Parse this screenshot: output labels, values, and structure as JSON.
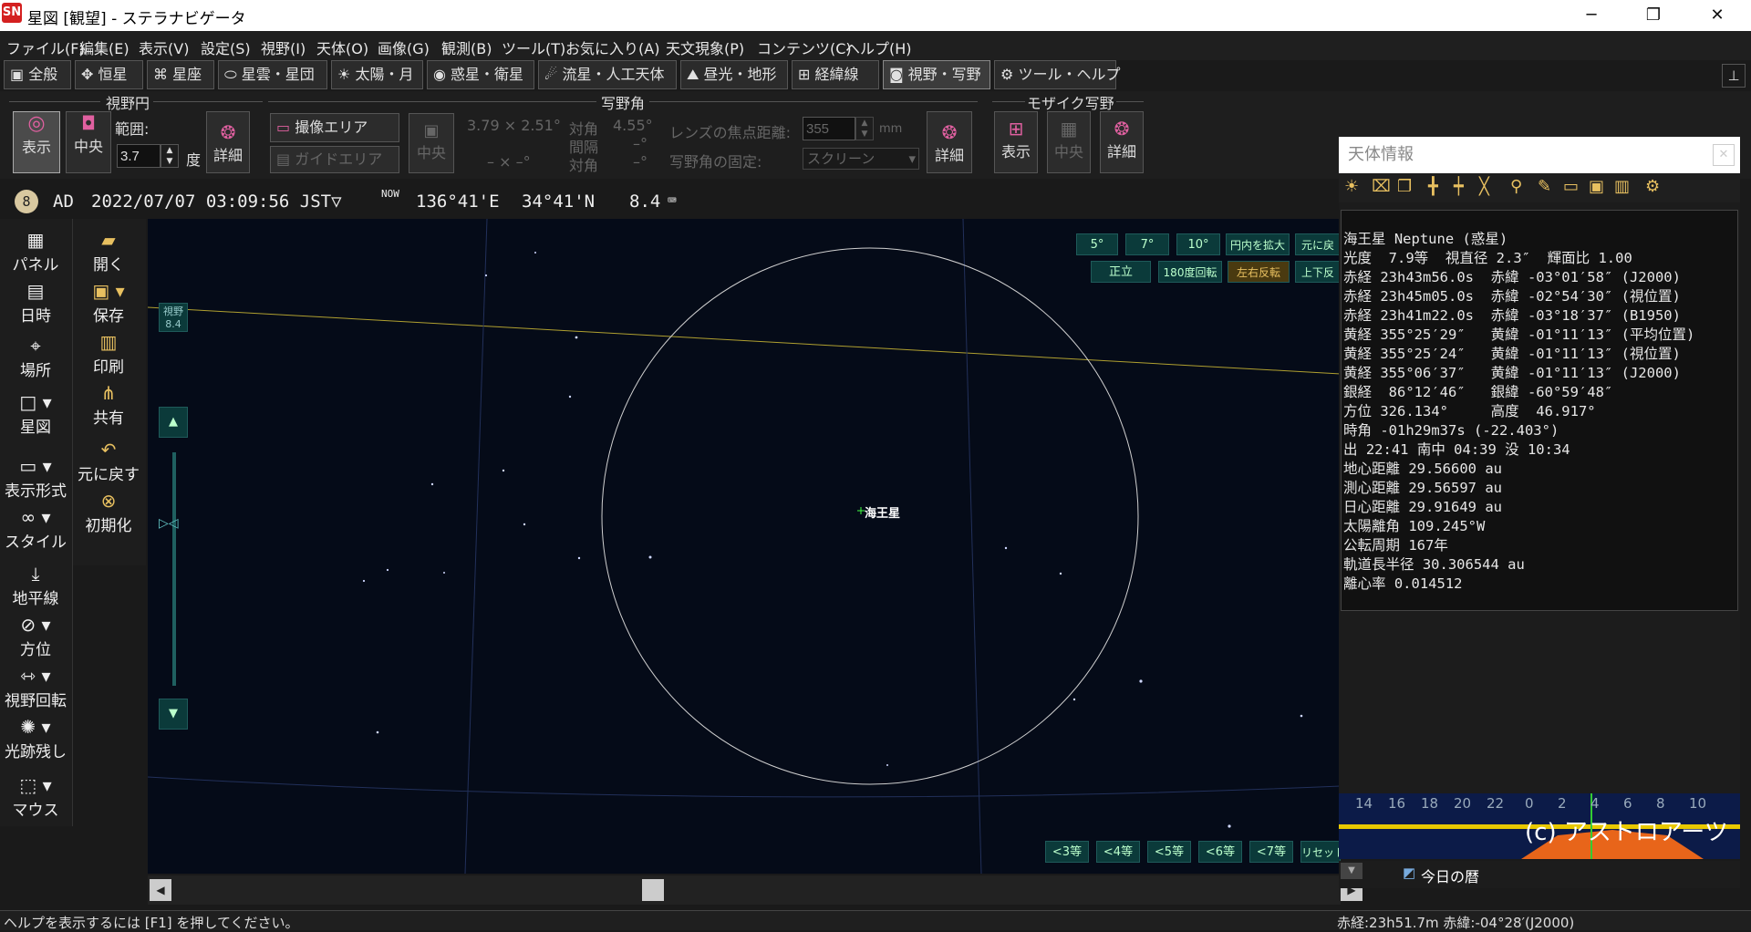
{
  "window": {
    "title": "星図 [観望] - ステラナビゲータ",
    "app_icon": "SN",
    "minimize": "─",
    "restore": "❐",
    "close": "✕"
  },
  "menu": [
    "ファイル(F)",
    "編集(E)",
    "表示(V)",
    "設定(S)",
    "視野(I)",
    "天体(O)",
    "画像(G)",
    "観測(B)",
    "ツール(T)",
    "お気に入り(A)",
    "天文現象(P)",
    "コンテンツ(C)",
    "ヘルプ(H)"
  ],
  "tabs": [
    "全般",
    "恒星",
    "星座",
    "星雲・星団",
    "太陽・月",
    "惑星・衛星",
    "流星・人工天体",
    "昼光・地形",
    "経緯線",
    "視野・写野",
    "ツール・ヘルプ"
  ],
  "ribbon": {
    "fov_group": "視野円",
    "fov_show": "表示",
    "fov_center": "中央",
    "fov_range_label": "範囲:",
    "fov_range_value": "3.7",
    "fov_unit": "度",
    "fov_detail": "詳細",
    "photo_group": "写野角",
    "capture_area": "撮像エリア",
    "guide_area": "ガイドエリア",
    "photo_center": "中央",
    "photo_size": "3.79 × 2.51°",
    "photo_diag_label": "対角",
    "photo_diag": "4.55°",
    "photo_interval_label": "間隔",
    "photo_interval": "–°",
    "photo_diag2_label": "対角",
    "photo_diag2": "–°",
    "photo_dash": "– ×     –°",
    "lens_label": "レンズの焦点距離:",
    "lens_value": "355",
    "lens_unit": "mm",
    "fix_label": "写野角の固定:",
    "fix_value": "スクリーン",
    "photo_detail": "詳細",
    "mosaic_group": "モザイク写野",
    "mosaic_show": "表示",
    "mosaic_center": "中央",
    "mosaic_detail": "詳細"
  },
  "status_line": {
    "era": "AD",
    "datetime": "2022/07/07 03:09:56 JST▽",
    "now": "NOW",
    "lon": "136°41'E",
    "lat": "34°41'N",
    "fov": "8.4"
  },
  "left_panel": [
    "パネル",
    "日時",
    "場所",
    "星図",
    "表示形式",
    "スタイル",
    "地平線",
    "方位",
    "視野回転",
    "光跡残し",
    "マウス"
  ],
  "left_panel2": [
    "開く",
    "保存",
    "印刷",
    "共有",
    "元に戻す",
    "初期化"
  ],
  "sky": {
    "fov_label": "視野",
    "fov_value": "8.4",
    "target": "海王星",
    "fov_buttons": [
      "5°",
      "7°",
      "10°",
      "円内を拡大",
      "元に戻"
    ],
    "orient_buttons": [
      "正立",
      "180度回転",
      "左右反転",
      "上下反"
    ],
    "mag_buttons": [
      "<3等",
      "<4等",
      "<5等",
      "<6等",
      "<7等",
      "リセット"
    ]
  },
  "info": {
    "header": "天体情報",
    "lines": [
      "海王星 Neptune (惑星)",
      "光度  7.9等  視直径 2.3″  輝面比 1.00",
      "赤経 23h43m56.0s  赤緯 -03°01′58″ (J2000)",
      "赤経 23h45m05.0s  赤緯 -02°54′30″ (視位置)",
      "赤経 23h41m22.0s  赤緯 -03°18′37″ (B1950)",
      "黄経 355°25′29″   黄緯 -01°11′13″ (平均位置)",
      "黄経 355°25′24″   黄緯 -01°11′13″ (視位置)",
      "黄経 355°06′37″   黄緯 -01°11′13″ (J2000)",
      "銀経  86°12′46″   銀緯 -60°59′48″",
      "方位 326.134°     高度  46.917°",
      "時角 -01h29m37s (-22.403°)",
      "出 22:41 南中 04:39 没 10:34",
      "地心距離 29.56600 au",
      "測心距離 29.56597 au",
      "日心距離 29.91649 au",
      "太陽離角 109.245°W",
      "公転周期 167年",
      "軌道長半径 30.306544 au",
      "離心率 0.014512"
    ]
  },
  "timeline": {
    "hours": [
      "14",
      "16",
      "18",
      "20",
      "22",
      "0",
      "2",
      "4",
      "6",
      "8",
      "10"
    ],
    "credit": "(c) アストロアーツ"
  },
  "today_calendar": "今日の暦",
  "statusbar": {
    "help": "ヘルプを表示するには [F1] を押してください。",
    "coords": "赤経:23h51.7m 赤緯:-04°28′(J2000)"
  }
}
